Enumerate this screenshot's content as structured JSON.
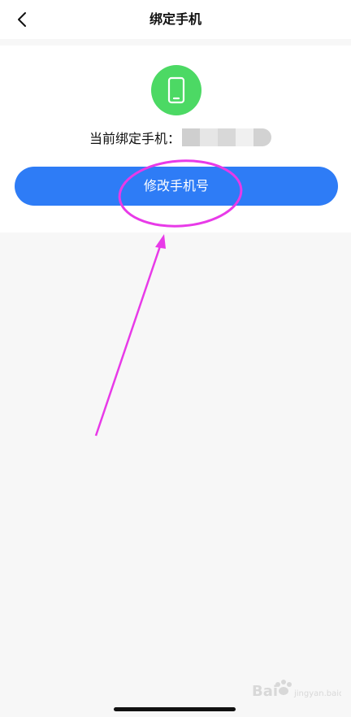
{
  "header": {
    "title": "绑定手机",
    "back_icon": "chevron-left-icon"
  },
  "card": {
    "phone_icon": "smartphone-icon",
    "phone_badge_color": "#4cd964",
    "current_label": "当前绑定手机：",
    "masked_number_blocks": [
      "#cfcfcf",
      "#e6e6e6",
      "#d8d8d8",
      "#f0f0f0",
      "#d2d2d2"
    ],
    "modify_button_label": "修改手机号",
    "button_color": "#2e7cf6"
  },
  "annotation": {
    "color": "#e83ae8",
    "shapes": [
      "highlight-ellipse",
      "pointer-arrow"
    ]
  },
  "watermark": {
    "logo_text": "Bai",
    "site_text": "jingyan.baidu.com"
  }
}
